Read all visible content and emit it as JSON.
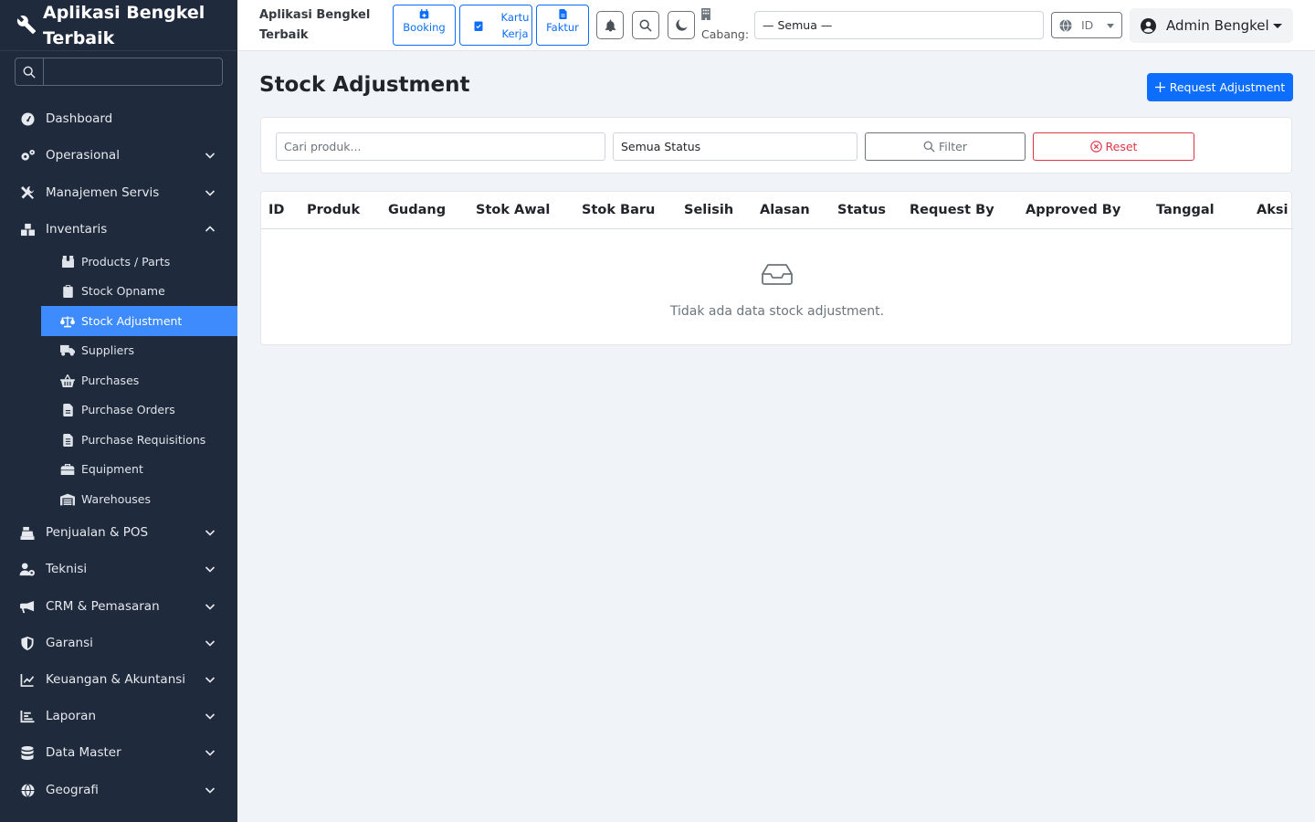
{
  "app": {
    "name": "Aplikasi Bengkel Terbaik"
  },
  "sidebar": {
    "search_placeholder": "",
    "items": [
      {
        "label": "Dashboard",
        "icon": "dashboard-icon",
        "has_chevron": false
      },
      {
        "label": "Operasional",
        "icon": "cogs-icon",
        "has_chevron": true
      },
      {
        "label": "Manajemen Servis",
        "icon": "tools-icon",
        "has_chevron": true
      },
      {
        "label": "Inventaris",
        "icon": "boxes-icon",
        "has_chevron": true,
        "expanded": true
      },
      {
        "label": "Penjualan & POS",
        "icon": "cash-register-icon",
        "has_chevron": true
      },
      {
        "label": "Teknisi",
        "icon": "user-cog-icon",
        "has_chevron": true
      },
      {
        "label": "CRM & Pemasaran",
        "icon": "bullhorn-icon",
        "has_chevron": true
      },
      {
        "label": "Garansi",
        "icon": "shield-icon",
        "has_chevron": true
      },
      {
        "label": "Keuangan & Akuntansi",
        "icon": "chart-line-icon",
        "has_chevron": true
      },
      {
        "label": "Laporan",
        "icon": "chart-bar-icon",
        "has_chevron": true
      },
      {
        "label": "Data Master",
        "icon": "database-icon",
        "has_chevron": true
      },
      {
        "label": "Geografi",
        "icon": "globe-icon",
        "has_chevron": true
      }
    ],
    "subitems": [
      {
        "label": "Products / Parts",
        "icon": "box-icon"
      },
      {
        "label": "Stock Opname",
        "icon": "clipboard-icon"
      },
      {
        "label": "Stock Adjustment",
        "icon": "balance-scale-icon",
        "active": true
      },
      {
        "label": "Suppliers",
        "icon": "truck-icon"
      },
      {
        "label": "Purchases",
        "icon": "basket-icon"
      },
      {
        "label": "Purchase Orders",
        "icon": "file-invoice-icon"
      },
      {
        "label": "Purchase Requisitions",
        "icon": "file-list-icon"
      },
      {
        "label": "Equipment",
        "icon": "toolbox-icon"
      },
      {
        "label": "Warehouses",
        "icon": "warehouse-icon"
      }
    ]
  },
  "topbar": {
    "app_name": "Aplikasi Bengkel Terbaik",
    "quick": [
      {
        "label": "Booking",
        "icon": "calendar-plus-icon"
      },
      {
        "label": "Kartu Kerja",
        "icon": "clipboard-check-icon"
      },
      {
        "label": "Faktur",
        "icon": "invoice-icon"
      }
    ],
    "cabang_label": "Cabang:",
    "cabang_value": "— Semua —",
    "language": "ID",
    "user": "Admin Bengkel"
  },
  "page": {
    "title": "Stock Adjustment",
    "request_button": "Request Adjustment"
  },
  "filters": {
    "search_placeholder": "Cari produk...",
    "status_value": "Semua Status",
    "filter_button": "Filter",
    "reset_button": "Reset"
  },
  "table": {
    "columns": [
      "ID",
      "Produk",
      "Gudang",
      "Stok Awal",
      "Stok Baru",
      "Selisih",
      "Alasan",
      "Status",
      "Request By",
      "Approved By",
      "Tanggal",
      "Aksi"
    ],
    "rows": [],
    "empty_message": "Tidak ada data stock adjustment."
  },
  "colors": {
    "sidebar_bg": "#1f2a3c",
    "accent": "#0d6efd",
    "active_item": "#3d8bfd",
    "danger": "#dc3545"
  }
}
